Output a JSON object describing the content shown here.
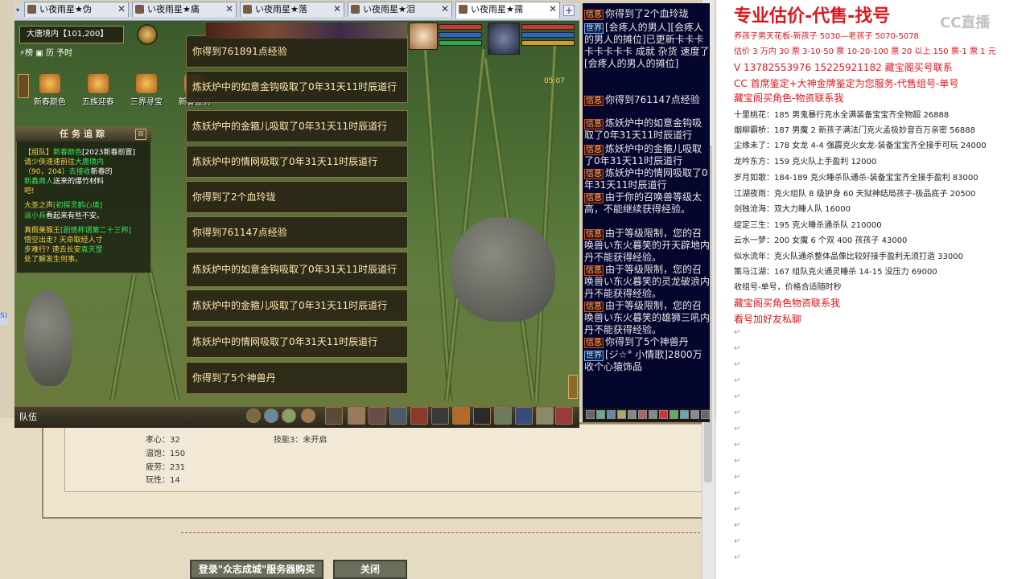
{
  "tabs": [
    {
      "label": "い夜雨星★伪"
    },
    {
      "label": "い夜雨星★痛"
    },
    {
      "label": "い夜雨星★落"
    },
    {
      "label": "い夜雨星★泪"
    },
    {
      "label": "い夜雨星★孺"
    }
  ],
  "game": {
    "location": "大唐境内【101,200】",
    "menu_row": "⚡榜 ▣ 历   予时",
    "funcs": [
      "新春颜色",
      "五族迎春",
      "三界寻宝",
      "新春签到"
    ],
    "task_title": "任务追踪",
    "tasks": [
      {
        "a": "【组队】",
        "b": "新春颜色",
        "c": "[2023新春前置]"
      },
      {
        "a": "请少侠速速前往",
        "b": "大唐境内",
        "c": ""
      },
      {
        "a": "（90，204）",
        "b": "去接收",
        "c": "新春的"
      },
      {
        "a": "",
        "b": "新鑫商人",
        "c": "送来的爆竹材料"
      },
      {
        "a": "吧!",
        "b": "",
        "c": ""
      },
      {
        "a": "大圣之声",
        "b": "[初探灵鹤心境]",
        "c": ""
      },
      {
        "a": "",
        "b": "派小兵",
        "c": "看起来有些不安。"
      },
      {
        "a": "真假美猴王",
        "b": "[剧情称谓第二十三称]",
        "c": ""
      },
      {
        "a": "悟空出走? 天命取经人寸",
        "b": "",
        "c": ""
      },
      {
        "a": "步难行? 速去长安",
        "b": "袁天罡",
        "c": ""
      },
      {
        "a": "处了解发生何事。",
        "b": "",
        "c": ""
      }
    ],
    "popups": [
      "你得到761891点经验",
      "炼妖炉中的如意金钩吸取了0年31天11时辰道行",
      "炼妖炉中的金箍儿吸取了0年31天11时辰道行",
      "炼妖炉中的情网吸取了0年31天11时辰道行",
      "你得到了2个血玲珑",
      "你得到761147点经验",
      "炼妖炉中的如意金钩吸取了0年31天11时辰道行",
      "炼妖炉中的金箍儿吸取了0年31天11时辰道行",
      "炼妖炉中的情网吸取了0年31天11时辰道行",
      "你得到了5个神兽丹"
    ],
    "team_label": "队伍",
    "timer": "05:07"
  },
  "chat": [
    {
      "tag": "信息",
      "text": "你得到了2个血玲珑"
    },
    {
      "tag": "世界",
      "text": "[会疼人的男人][会疼人的男人的摊位]已更新卡卡卡卡卡卡卡卡 成就 杂货 速度了[会疼人的男人的摊位]"
    },
    {
      "tag": "信息",
      "text": "你得到761147点经验"
    },
    {
      "tag": "信息",
      "text": "炼妖炉中的如意金钩吸取了0年31天11时辰道行"
    },
    {
      "tag": "信息",
      "text": "炼妖炉中的金箍儿吸取了0年31天11时辰道行"
    },
    {
      "tag": "信息",
      "text": "炼妖炉中的情网吸取了0年31天11时辰道行"
    },
    {
      "tag": "信息",
      "text": "由于你的召唤兽等级太高，不能继续获得经验。"
    },
    {
      "tag": "信息",
      "text": "由于等级限制，您的召唤兽い东火暮笑的开天辟地内丹不能获得经验。"
    },
    {
      "tag": "信息",
      "text": "由于等级限制，您的召唤兽い东火暮笑的灵龙破浪内丹不能获得经验。"
    },
    {
      "tag": "信息",
      "text": "由于等级限制，您的召唤兽い东火暮笑的雄狮三吼内丹不能获得经验。"
    },
    {
      "tag": "信息",
      "text": "你得到了5个神兽丹"
    },
    {
      "tag": "世界",
      "text": "[ジ☆° 小情歌]2800万收个心猿饰品"
    }
  ],
  "bg": {
    "stats": [
      "孝心：32",
      "温饱：150",
      "疲劳：231",
      "玩性：14"
    ],
    "skill": "技能3：未开启",
    "btn_login": "登录\"众志成城\"服务器购买",
    "btn_close": "关闭"
  },
  "right": {
    "title": "专业估价-代售-找号",
    "lines": [
      {
        "t": "养孩子男天花板-新孩子 5030—老孩子 5070-5078",
        "c": "red2"
      },
      {
        "t": "估价 3 万内 30 票  3-10-50 票  10-20-100 票  20 以上 150 票-1 票 1 元",
        "c": "red2"
      },
      {
        "t": "V 13782553976    15225921182   藏宝阁买号联系",
        "c": "red"
      },
      {
        "t": "CC 首席鉴定+大神金牌鉴定为您服务-代售组号-单号",
        "c": "red"
      },
      {
        "t": "藏宝阁买角色-物资联系我",
        "c": "red"
      },
      {
        "t": "十里桃花：185 男鬼暴行克水全满装备宝宝齐全物超 26888",
        "c": "n"
      },
      {
        "t": "烟柳霸桥：187 男魔 2 新孩子满法门克火孟极妙音百万亲密 56888",
        "c": "n"
      },
      {
        "t": "尘缘未了：178 女龙 4-4 强霹克火女龙-装备宝宝齐全接手可玩 24000",
        "c": "n"
      },
      {
        "t": "龙吟东方：159 克火队上手盈利 12000",
        "c": "n"
      },
      {
        "t": "岁月如歌：184-189 克火睡杀队通杀-装备宝宝齐全接手盈利 83000",
        "c": "n"
      },
      {
        "t": "江湖夜雨：克火组队 8 级护身 60 天狱神结局孩子-极品底子 20500",
        "c": "n"
      },
      {
        "t": "剑独沧海：双大力睡人队 16000",
        "c": "n"
      },
      {
        "t": "绽定三生：195 克火睡杀通杀队 210000",
        "c": "n"
      },
      {
        "t": "云水一梦：200 女魔 6 个双 400 孩孩子 43000",
        "c": "n"
      },
      {
        "t": "似水流年：克火队通杀整体品像比较好接手盈利无须打造 33000",
        "c": "n"
      },
      {
        "t": "策马江湖：167 组队克火通灵睡杀 14-15 没压力 69000",
        "c": "n"
      },
      {
        "t": "收组号-单号，价格合适随时秒",
        "c": "n"
      },
      {
        "t": "藏宝阁买角色物资联系我",
        "c": "red"
      },
      {
        "t": "看号加好友私聊",
        "c": "red"
      }
    ],
    "watermark": "CC直播"
  }
}
